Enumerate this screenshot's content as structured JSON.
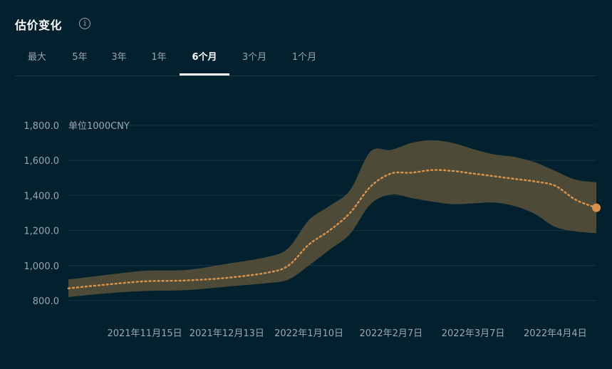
{
  "header": {
    "title": "估价变化",
    "info_icon": "info-icon"
  },
  "tabs": [
    {
      "label": "最大"
    },
    {
      "label": "5年"
    },
    {
      "label": "3年"
    },
    {
      "label": "1年"
    },
    {
      "label": "6个月"
    },
    {
      "label": "3个月"
    },
    {
      "label": "1个月"
    }
  ],
  "active_tab": "6个月",
  "colors": {
    "background": "#03202e",
    "band": "#4d4a38",
    "line": "#d9924a",
    "grid": "#163443",
    "text_muted": "#9aa7ae"
  },
  "chart_data": {
    "type": "line",
    "unit_label": "单位1000CNY",
    "ylim": [
      800,
      1800
    ],
    "y_ticks": [
      "1,800.0",
      "1,600.0",
      "1,400.0",
      "1,200.0",
      "1,000.0",
      "800.0"
    ],
    "y_tick_values": [
      1800,
      1600,
      1400,
      1200,
      1000,
      800
    ],
    "x_range": [
      "2021-10-20",
      "2022-04-18"
    ],
    "x_tick_labels": [
      "2021年11月15日",
      "2021年12月13日",
      "2022年1月10日",
      "2022年2月7日",
      "2022年3月7日",
      "2022年4月4日"
    ],
    "x_tick_dates": [
      "2021-11-15",
      "2021-12-13",
      "2022-01-10",
      "2022-02-07",
      "2022-03-07",
      "2022-04-04"
    ],
    "grid": true,
    "series": [
      {
        "x": [
          "2021-10-20",
          "2021-11-01",
          "2021-11-15",
          "2021-11-29",
          "2021-12-13",
          "2021-12-27",
          "2022-01-03",
          "2022-01-10",
          "2022-01-17",
          "2022-01-24",
          "2022-01-31",
          "2022-02-07",
          "2022-02-14",
          "2022-02-21",
          "2022-02-28",
          "2022-03-07",
          "2022-03-14",
          "2022-03-21",
          "2022-03-28",
          "2022-04-04",
          "2022-04-11",
          "2022-04-18"
        ],
        "values": [
          870,
          890,
          910,
          915,
          930,
          960,
          1000,
          1120,
          1200,
          1300,
          1450,
          1525,
          1530,
          1545,
          1540,
          1525,
          1510,
          1495,
          1480,
          1455,
          1375,
          1330
        ],
        "upper": [
          920,
          945,
          970,
          975,
          1010,
          1050,
          1100,
          1260,
          1340,
          1430,
          1650,
          1660,
          1700,
          1715,
          1700,
          1665,
          1635,
          1620,
          1590,
          1540,
          1490,
          1475
        ],
        "lower": [
          820,
          840,
          855,
          860,
          880,
          900,
          920,
          1000,
          1090,
          1180,
          1350,
          1405,
          1385,
          1365,
          1350,
          1355,
          1360,
          1340,
          1295,
          1220,
          1195,
          1185
        ]
      }
    ]
  }
}
